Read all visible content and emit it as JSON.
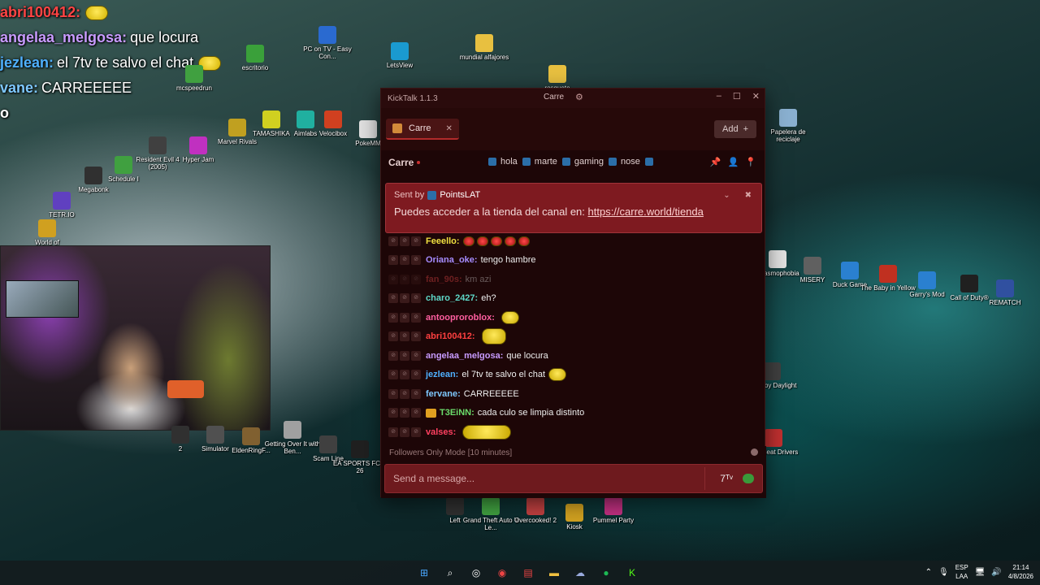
{
  "overlay_chat": [
    {
      "user": "abri100412:",
      "text": "",
      "color": "#ff4444",
      "emote": true
    },
    {
      "user": "angelaa_melgosa:",
      "text": "que locura",
      "color": "#c89bff",
      "emote": false
    },
    {
      "user": "jezlean:",
      "text": "el 7tv te salvo el chat",
      "color": "#4fb0ff",
      "emote": true
    },
    {
      "user": "vane:",
      "text": "CARREEEEE",
      "color": "#7ec8ff",
      "emote": false
    },
    {
      "user": "o",
      "text": "",
      "color": "#ffffff",
      "emote": false
    }
  ],
  "desktop_icons": [
    {
      "label": "escritorio",
      "color": "#3aa03a"
    },
    {
      "label": "PC on TV - Easy Con...",
      "color": "#2a6ad0"
    },
    {
      "label": "LetsView",
      "color": "#1a9ad0"
    },
    {
      "label": "mundial alfajores",
      "color": "#e8c040"
    },
    {
      "label": "rosquete",
      "color": "#e8c040"
    },
    {
      "label": "mcspeedrun",
      "color": "#40a040"
    },
    {
      "label": "Marvel Rivals",
      "color": "#c0a020"
    },
    {
      "label": "TAMASHIKA",
      "color": "#d0d020"
    },
    {
      "label": "Aimlabs",
      "color": "#20b0a0"
    },
    {
      "label": "Velocibox",
      "color": "#d04020"
    },
    {
      "label": "PokeMM",
      "color": "#e0e0e0"
    },
    {
      "label": "Resident Evil 4 (2005)",
      "color": "#404040"
    },
    {
      "label": "Hyper Jam",
      "color": "#c030c0"
    },
    {
      "label": "Schedule I",
      "color": "#40a040"
    },
    {
      "label": "Megabonk",
      "color": "#303030"
    },
    {
      "label": "TETR.IO",
      "color": "#6040c0"
    },
    {
      "label": "World of",
      "color": "#d0a020"
    },
    {
      "label": "Papelera de reciclaje",
      "color": "#8ab0d0"
    },
    {
      "label": "Phasmophobia",
      "color": "#e0e0e0"
    },
    {
      "label": "MISERY",
      "color": "#606060"
    },
    {
      "label": "Duck Game",
      "color": "#2a80d0"
    },
    {
      "label": "The Baby in Yellow",
      "color": "#c03020"
    },
    {
      "label": "Garry's Mod",
      "color": "#2a80d0"
    },
    {
      "label": "Call of Duty®",
      "color": "#202020"
    },
    {
      "label": "REMATCH",
      "color": "#3050a0"
    },
    {
      "label": "Dead by Daylight",
      "color": "#404040"
    },
    {
      "label": "Backseat Drivers",
      "color": "#c03030"
    },
    {
      "label": "Simulator",
      "color": "#505050"
    },
    {
      "label": "EldenRingF...",
      "color": "#806030"
    },
    {
      "label": "Getting Over It with Ben...",
      "color": "#a0a0a0"
    },
    {
      "label": "Scam Line",
      "color": "#404040"
    },
    {
      "label": "EA SPORTS FC™ 26",
      "color": "#202020"
    },
    {
      "label": "Left",
      "color": "#303030"
    },
    {
      "label": "Grand Theft Auto V Le...",
      "color": "#40a040"
    },
    {
      "label": "Overcooked! 2",
      "color": "#c04040"
    },
    {
      "label": "Kiosk",
      "color": "#d0a020"
    },
    {
      "label": "Pummel Party",
      "color": "#c03080"
    },
    {
      "label": "2",
      "color": "#303030"
    }
  ],
  "kicktalk": {
    "app_title": "KickTalk 1.1.3",
    "center_label": "Carre",
    "tab_name": "Carre",
    "add_label": "Add",
    "channel": "Carre",
    "channel_links": [
      "hola",
      "marte",
      "gaming",
      "nose"
    ],
    "pinned": {
      "sent_by_prefix": "Sent by",
      "sender": "PointsLAT",
      "message_prefix": "Puedes acceder a la tienda del canal en:",
      "link": "https://carre.world/tienda"
    },
    "messages": [
      {
        "user": "Feeello:",
        "text": "",
        "color": "#f0e040",
        "emote": "row",
        "faded": false
      },
      {
        "user": "Oriana_oke:",
        "text": "tengo hambre",
        "color": "#a68cff",
        "emote": "",
        "faded": false
      },
      {
        "user": "fan_90s:",
        "text": "km azi",
        "color": "#ff4f4f",
        "emote": "",
        "faded": true
      },
      {
        "user": "charo_2427:",
        "text": "eh?",
        "color": "#5ed8c8",
        "emote": "",
        "faded": false
      },
      {
        "user": "antooproroblox:",
        "text": "",
        "color": "#ff5fa0",
        "emote": "small",
        "faded": false
      },
      {
        "user": "abri100412:",
        "text": "",
        "color": "#ff4040",
        "emote": "big",
        "faded": false
      },
      {
        "user": "angelaa_melgosa:",
        "text": "que locura",
        "color": "#c89bff",
        "emote": "",
        "faded": false
      },
      {
        "user": "jezlean:",
        "text": "el 7tv te salvo el chat",
        "color": "#4fb0ff",
        "emote": "small",
        "faded": false
      },
      {
        "user": "fervane:",
        "text": "CARREEEEE",
        "color": "#7ec8ff",
        "emote": "",
        "faded": false
      },
      {
        "user": "T3EiNN:",
        "text": "cada culo se limpia distinto",
        "color": "#6bdc6b",
        "emote": "",
        "faded": false,
        "badge": true
      },
      {
        "user": "valses:",
        "text": "",
        "color": "#ff4060",
        "emote": "wide",
        "faded": false
      }
    ],
    "followers_mode": "Followers Only Mode [10 minutes]",
    "input_placeholder": "Send a message..."
  },
  "taskbar": {
    "lang_top": "ESP",
    "lang_bottom": "LAA",
    "time": "21:14",
    "date": "4/8/2026"
  }
}
